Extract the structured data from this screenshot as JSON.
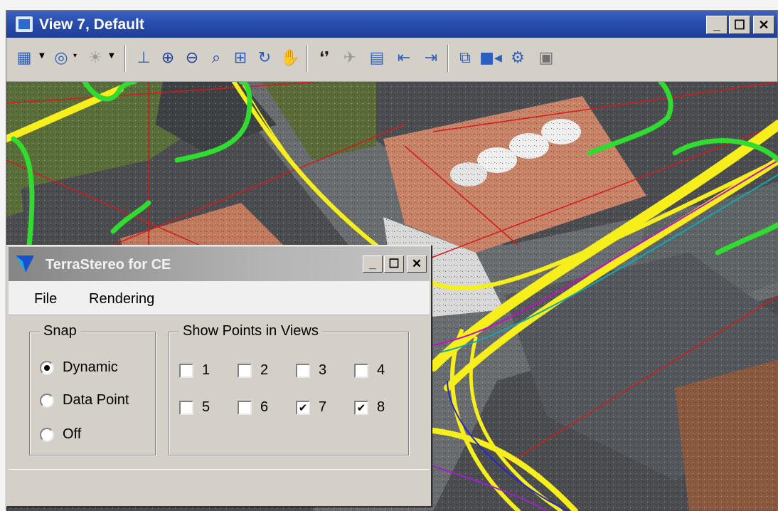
{
  "view_window": {
    "title": "View 7, Default",
    "controls": {
      "minimize": "_",
      "maximize": "☐",
      "close": "✕"
    },
    "toolbar": {
      "icons": [
        "view-attributes-icon",
        "levels-icon",
        "lighting-icon",
        "update-view-icon",
        "zoom-in-icon",
        "zoom-out-icon",
        "window-area-icon",
        "fit-view-icon",
        "rotate-view-icon",
        "pan-view-icon",
        "walk-icon",
        "fly-icon",
        "copy-view-icon",
        "previous-view-icon",
        "next-view-icon",
        "clip-volume-icon",
        "camera-icon",
        "view-settings-icon",
        "render-icon"
      ]
    }
  },
  "dialog": {
    "title": "TerraStereo for CE",
    "controls": {
      "minimize": "_",
      "maximize": "☐",
      "close": "✕"
    },
    "menu": {
      "file": "File",
      "rendering": "Rendering"
    },
    "snap": {
      "legend": "Snap",
      "options": [
        {
          "label": "Dynamic",
          "selected": true
        },
        {
          "label": "Data Point",
          "selected": false
        },
        {
          "label": "Off",
          "selected": false
        }
      ]
    },
    "show_points": {
      "legend": "Show Points in Views",
      "views": [
        {
          "label": "1",
          "checked": false,
          "mark": ""
        },
        {
          "label": "2",
          "checked": false,
          "mark": ""
        },
        {
          "label": "3",
          "checked": false,
          "mark": ""
        },
        {
          "label": "4",
          "checked": false,
          "mark": ""
        },
        {
          "label": "5",
          "checked": false,
          "mark": ""
        },
        {
          "label": "6",
          "checked": false,
          "mark": ""
        },
        {
          "label": "7",
          "checked": true,
          "mark": "✔"
        },
        {
          "label": "8",
          "checked": true,
          "mark": "✔"
        }
      ]
    }
  },
  "colors": {
    "title_blue": "#2a4fb0",
    "highlight_yellow": "#f7ef1b",
    "highlight_green": "#2fdc2f",
    "breakline_red": "#d61a1a"
  }
}
